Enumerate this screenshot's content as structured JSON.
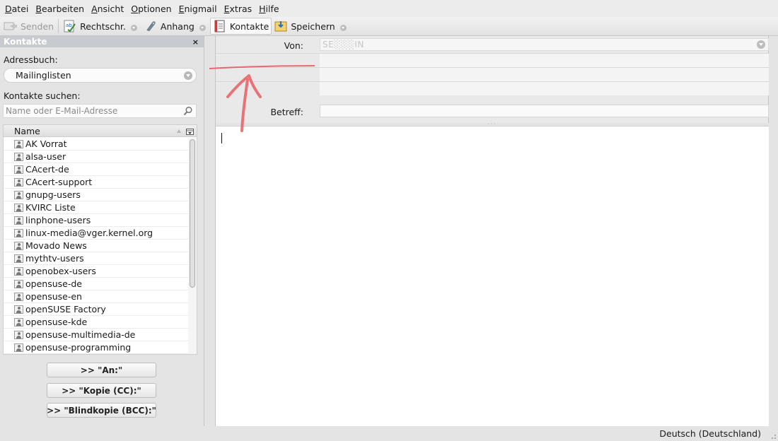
{
  "menu": [
    {
      "accel": "D",
      "rest": "atei"
    },
    {
      "accel": "B",
      "rest": "earbeiten"
    },
    {
      "accel": "A",
      "rest": "nsicht"
    },
    {
      "accel": "O",
      "rest": "ptionen"
    },
    {
      "accel": "E",
      "rest": "nigmail"
    },
    {
      "accel": "E",
      "rest": "xtras"
    },
    {
      "accel": "H",
      "rest": "ilfe"
    }
  ],
  "toolbar": {
    "send": "Senden",
    "spell": "Rechtschr.",
    "attach": "Anhang",
    "contacts": "Kontakte",
    "save": "Speichern"
  },
  "sidebar": {
    "title": "Kontakte",
    "close": "×",
    "addressbook_label": "Adressbuch:",
    "addressbook_value": "Mailinglisten",
    "search_label": "Kontakte suchen:",
    "search_placeholder": "Name oder E-Mail-Adresse",
    "column_name": "Name",
    "contacts": [
      "AK Vorrat",
      "alsa-user",
      "CAcert-de",
      "CAcert-support",
      "gnupg-users",
      "KVIRC Liste",
      "linphone-users",
      "linux-media@vger.kernel.org",
      "Movado News",
      "mythtv-users",
      "openobex-users",
      "opensuse-de",
      "opensuse-en",
      "openSUSE Factory",
      "opensuse-kde",
      "opensuse-multimedia-de",
      "opensuse-programming"
    ],
    "btn_to": ">> \"An:\"",
    "btn_cc": ">> \"Kopie (CC):\"",
    "btn_bcc": ">> \"Blindkopie (BCC):\""
  },
  "compose": {
    "from_label": "Von:",
    "from_value": "SE░░░IN",
    "subject_label": "Betreff:",
    "subject_value": ""
  },
  "status": {
    "language": "Deutsch (Deutschland)"
  },
  "colors": {
    "annotation": "#e8545a",
    "sidebar_header": "#c7cbd0"
  }
}
